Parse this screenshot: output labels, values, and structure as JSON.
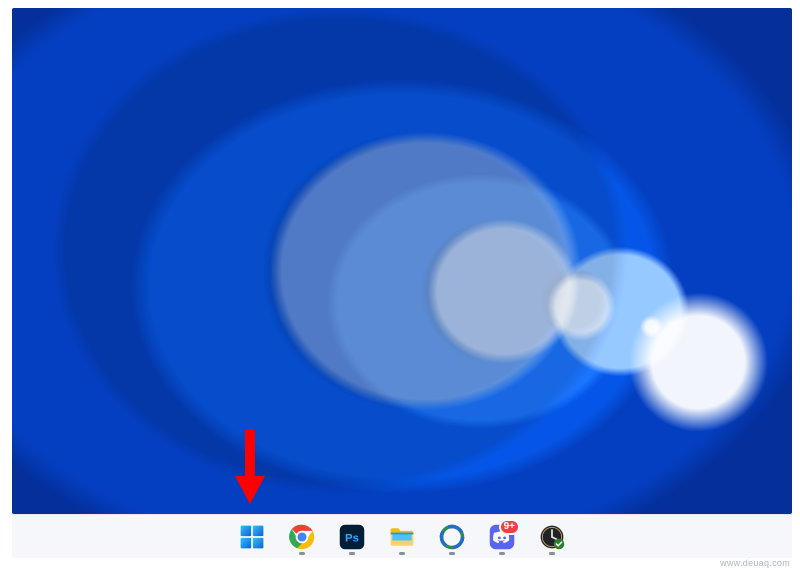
{
  "taskbar": {
    "items": [
      {
        "name": "start-button",
        "icon": "windows-start-icon",
        "running": false
      },
      {
        "name": "chrome-button",
        "icon": "chrome-icon",
        "running": true
      },
      {
        "name": "photoshop-button",
        "icon": "photoshop-icon",
        "running": true
      },
      {
        "name": "file-explorer-button",
        "icon": "file-explorer-icon",
        "running": true
      },
      {
        "name": "sharex-button",
        "icon": "sharex-icon",
        "running": true
      },
      {
        "name": "discord-button",
        "icon": "discord-icon",
        "running": true,
        "badge": "9+"
      },
      {
        "name": "clock-app-button",
        "icon": "clock-icon",
        "running": true
      }
    ]
  },
  "annotation": {
    "target": "start-button",
    "arrow_color": "#ff0000"
  },
  "watermark": "www.deuaq.com",
  "colors": {
    "taskbar_bg": "#f6f7fa",
    "accent_blue": "#0a63d6",
    "arrow_red": "#ff0000",
    "badge_red": "#f23f42"
  }
}
